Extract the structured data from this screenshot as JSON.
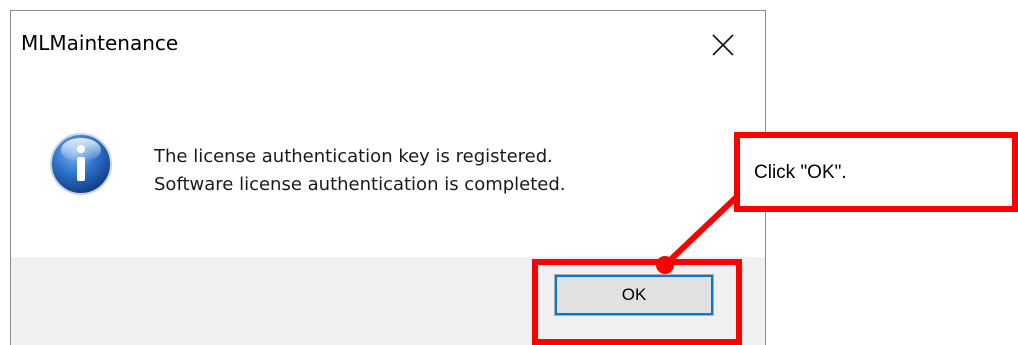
{
  "dialog": {
    "title": "MLMaintenance",
    "message_line1": "The license authentication key is registered.",
    "message_line2": "Software license authentication is completed.",
    "ok_label": "OK",
    "icon": "info-icon",
    "close_icon": "close-icon"
  },
  "annotation": {
    "callout_text": "Click \"OK\".",
    "color": "#ff0000"
  },
  "colors": {
    "footer_bg": "#f0f0f0",
    "button_bg": "#e1e1e1",
    "focus_outline": "#0078d7",
    "annotation_red": "#ff0000"
  }
}
